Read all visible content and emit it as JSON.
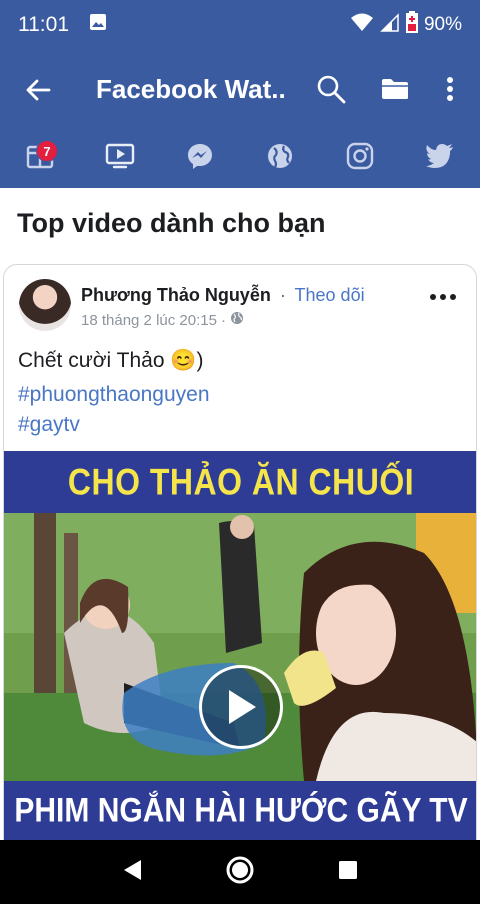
{
  "status_bar": {
    "time": "11:01",
    "battery": "90%",
    "icons": [
      "image-icon",
      "wifi-icon",
      "signal-icon",
      "battery-icon"
    ]
  },
  "app_bar": {
    "title": "Facebook Wat...",
    "icons": [
      "back-arrow-icon",
      "search-icon",
      "folder-icon",
      "more-vertical-icon"
    ]
  },
  "tabs": {
    "items": [
      "news-feed-icon",
      "watch-icon",
      "messenger-icon",
      "globe-icon",
      "instagram-icon",
      "twitter-icon"
    ],
    "badge_count": "7"
  },
  "feed": {
    "section_title": "Top video dành cho bạn",
    "post": {
      "author": "Phương Thảo Nguyễn",
      "separator": "·",
      "follow_label": "Theo dõi",
      "timestamp": "18 tháng 2 lúc 20:15",
      "meta_separator": "·",
      "text": "Chết cười Thảo 😊)",
      "hashtags": [
        "#phuongthaonguyen",
        "#gaytv"
      ],
      "video": {
        "top_caption": "CHO THẢO ĂN CHUỐI",
        "bottom_caption": "PHIM NGẮN HÀI HƯỚC GÃY TV"
      }
    }
  },
  "colors": {
    "brand_blue": "#3b5ba0",
    "link_blue": "#4a76c6",
    "badge_red": "#e41e3f",
    "caption_yellow": "#f5e44a"
  },
  "nav_bar": {
    "icons": [
      "back-triangle-icon",
      "home-circle-icon",
      "recents-square-icon"
    ]
  }
}
